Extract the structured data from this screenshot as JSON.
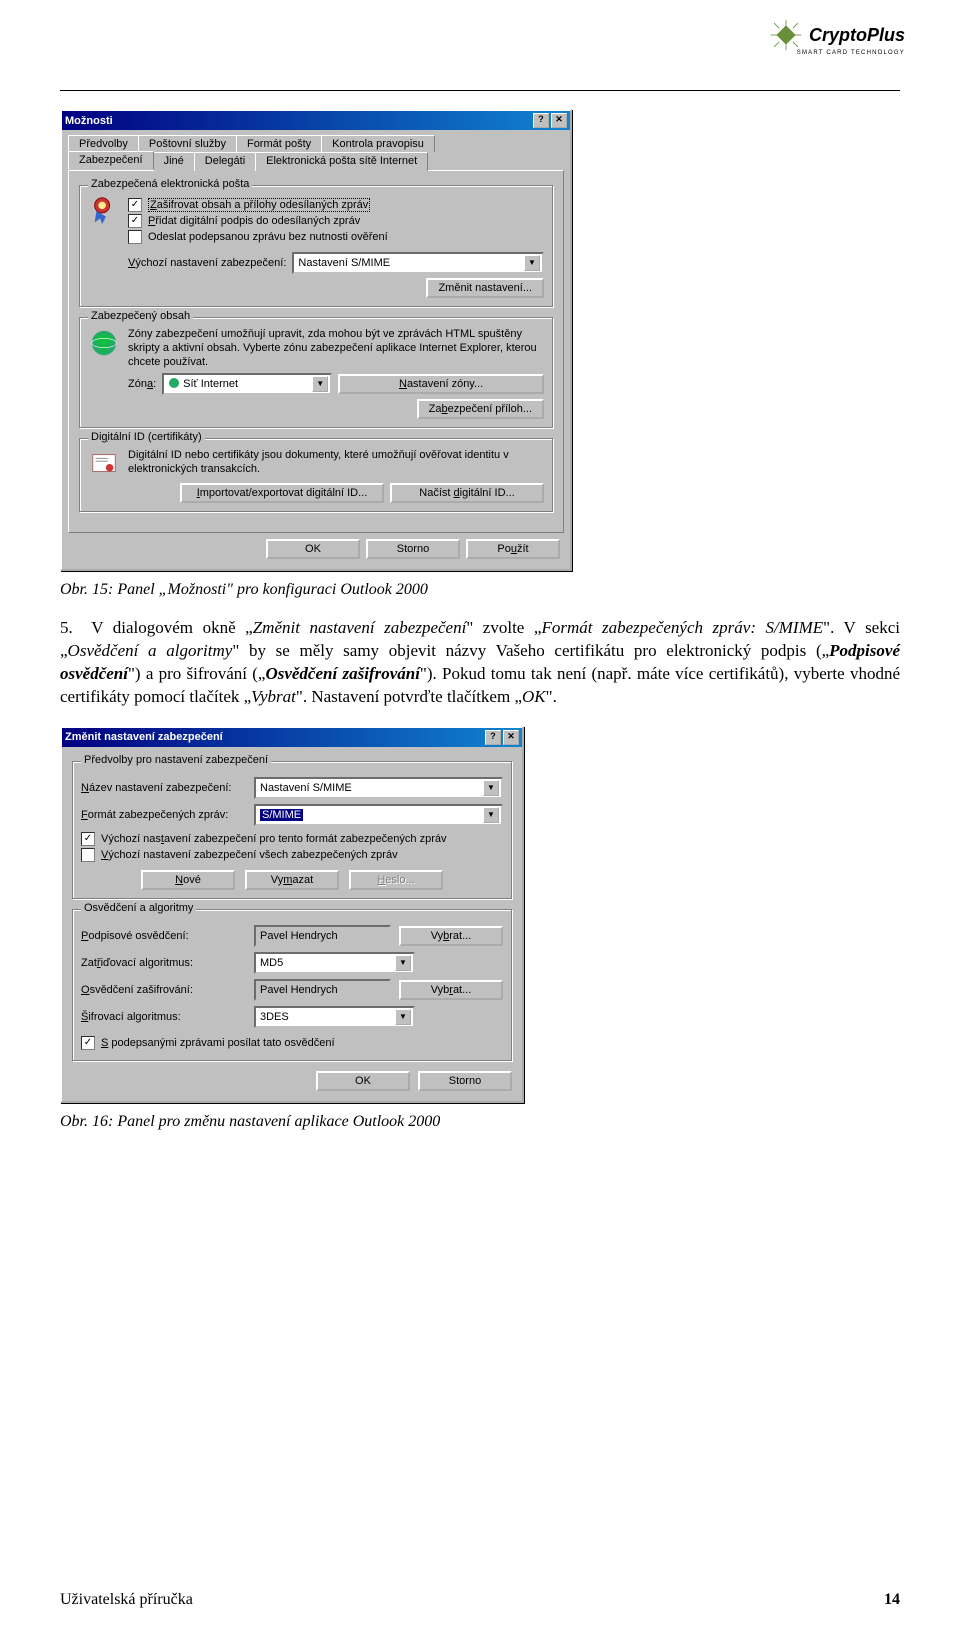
{
  "brand": {
    "name": "CryptoPlus",
    "tagline": "SMART CARD TECHNOLOGY"
  },
  "dialog1": {
    "title": "Možnosti",
    "tabs_upper": [
      "Předvolby",
      "Poštovní služby",
      "Formát pošty",
      "Kontrola pravopisu"
    ],
    "tabs_lower": [
      "Zabezpečení",
      "Jiné",
      "Delegáti",
      "Elektronická pošta sítě Internet"
    ],
    "group1": {
      "title": "Zabezpečená elektronická pošta",
      "cb1_rest": "ašifrovat obsah a přílohy odesílaných zpráv",
      "cb2_rest": "řidat digitální podpis do odesílaných zpráv",
      "cb3": "Odeslat podepsanou zprávu bez nutnosti ověření",
      "default_label_rest": "ýchozí nastavení zabezpečení:",
      "default_value": "Nastavení S/MIME",
      "change_btn": "Změnit nastavení..."
    },
    "group2": {
      "title": "Zabezpečený obsah",
      "desc": "Zóny zabezpečení umožňují upravit, zda mohou být ve zprávách HTML spuštěny skripty a aktivní obsah. Vyberte zónu zabezpečení aplikace Internet Explorer, kterou chcete používat.",
      "zone_pre": "Zón",
      "zone_value": "Síť Internet",
      "zone_btn_rest": "astavení zóny...",
      "attach_btn_pre": "Za",
      "attach_btn_post": "ezpečení příloh..."
    },
    "group3": {
      "title_pre": "Di",
      "title_post": "itální ID (certifikáty)",
      "desc": "Digitální ID nebo certifikáty jsou dokumenty, které umožňují ověřovat identitu v elektronických transakcích.",
      "btn1_rest": "mportovat/exportovat digitální ID...",
      "btn2_pre": "Načíst ",
      "btn2_post": "igitální ID..."
    },
    "footer": {
      "ok": "OK",
      "cancel": "Storno",
      "apply_pre": "Po",
      "apply_post": "žít"
    }
  },
  "caption1": "Obr. 15: Panel „Možnosti\" pro konfiguraci Outlook 2000",
  "body": {
    "step_num": "5.",
    "t1": "V dialogovém okně „",
    "i1": "Změnit nastavení zabezpečení",
    "t2": "\" zvolte „",
    "i2": "Formát zabezpečených zpráv: S/MIME",
    "t3": "\". V sekci „",
    "i3": "Osvědčení a algoritmy",
    "t4": "\" by se měly samy objevit názvy Vašeho certifikátu pro elektronický podpis („",
    "bi1": "Podpisové osvědčení",
    "t5": "\") a pro šifrování („",
    "bi2": "Osvědčení zašifrování",
    "t6": "\"). Pokud tomu tak není (např. máte více certifikátů), vyberte vhodné certifikáty pomocí tlačítek „",
    "i4": "Vybrat",
    "t7": "\". Nastavení potvrďte tlačítkem „",
    "i5": "OK",
    "t8": "\"."
  },
  "dialog2": {
    "title": "Změnit nastavení zabezpečení",
    "group1": {
      "title": "Předvolby pro nastavení zabezpečení",
      "name_label_rest": "ázev nastavení zabezpečení:",
      "name_value": "Nastavení S/MIME",
      "format_label_rest": "ormát zabezpečených zpráv:",
      "format_value": "S/MIME",
      "cb1_pre": "Výchozí nas",
      "cb1_post": "avení zabezpečení pro tento formát zabezpečených zpráv",
      "cb2_rest": "ýchozí nastavení zabezpečení všech zabezpečených zpráv",
      "btn_new_rest": "ové",
      "btn_del_pre": "Vy",
      "btn_del_post": "azat",
      "btn_pwd_rest": "eslo..."
    },
    "group2": {
      "title": "Osvědčení a algoritmy",
      "sign_label_rest": "odpisové osvědčení:",
      "sign_value": "Pavel Hendrych",
      "choose_pre": "Vy",
      "choose_post": "rat...",
      "hash_pre": "Zat",
      "hash_post": "iďovací algoritmus:",
      "hash_value": "MD5",
      "enc_label_rest": "svědčení zašifrování:",
      "enc_value": "Pavel Hendrych",
      "choose2_pre": "Vyb",
      "choose2_post": "at...",
      "encalgo_label_rest": "ifrovací algoritmus:",
      "encalgo_value": "3DES",
      "cb_rest": " podepsanými zprávami posílat tato osvědčení"
    },
    "footer": {
      "ok": "OK",
      "cancel": "Storno"
    }
  },
  "caption2": "Obr. 16: Panel pro změnu nastavení aplikace Outlook 2000",
  "footer": {
    "left": "Uživatelská příručka",
    "page": "14"
  }
}
